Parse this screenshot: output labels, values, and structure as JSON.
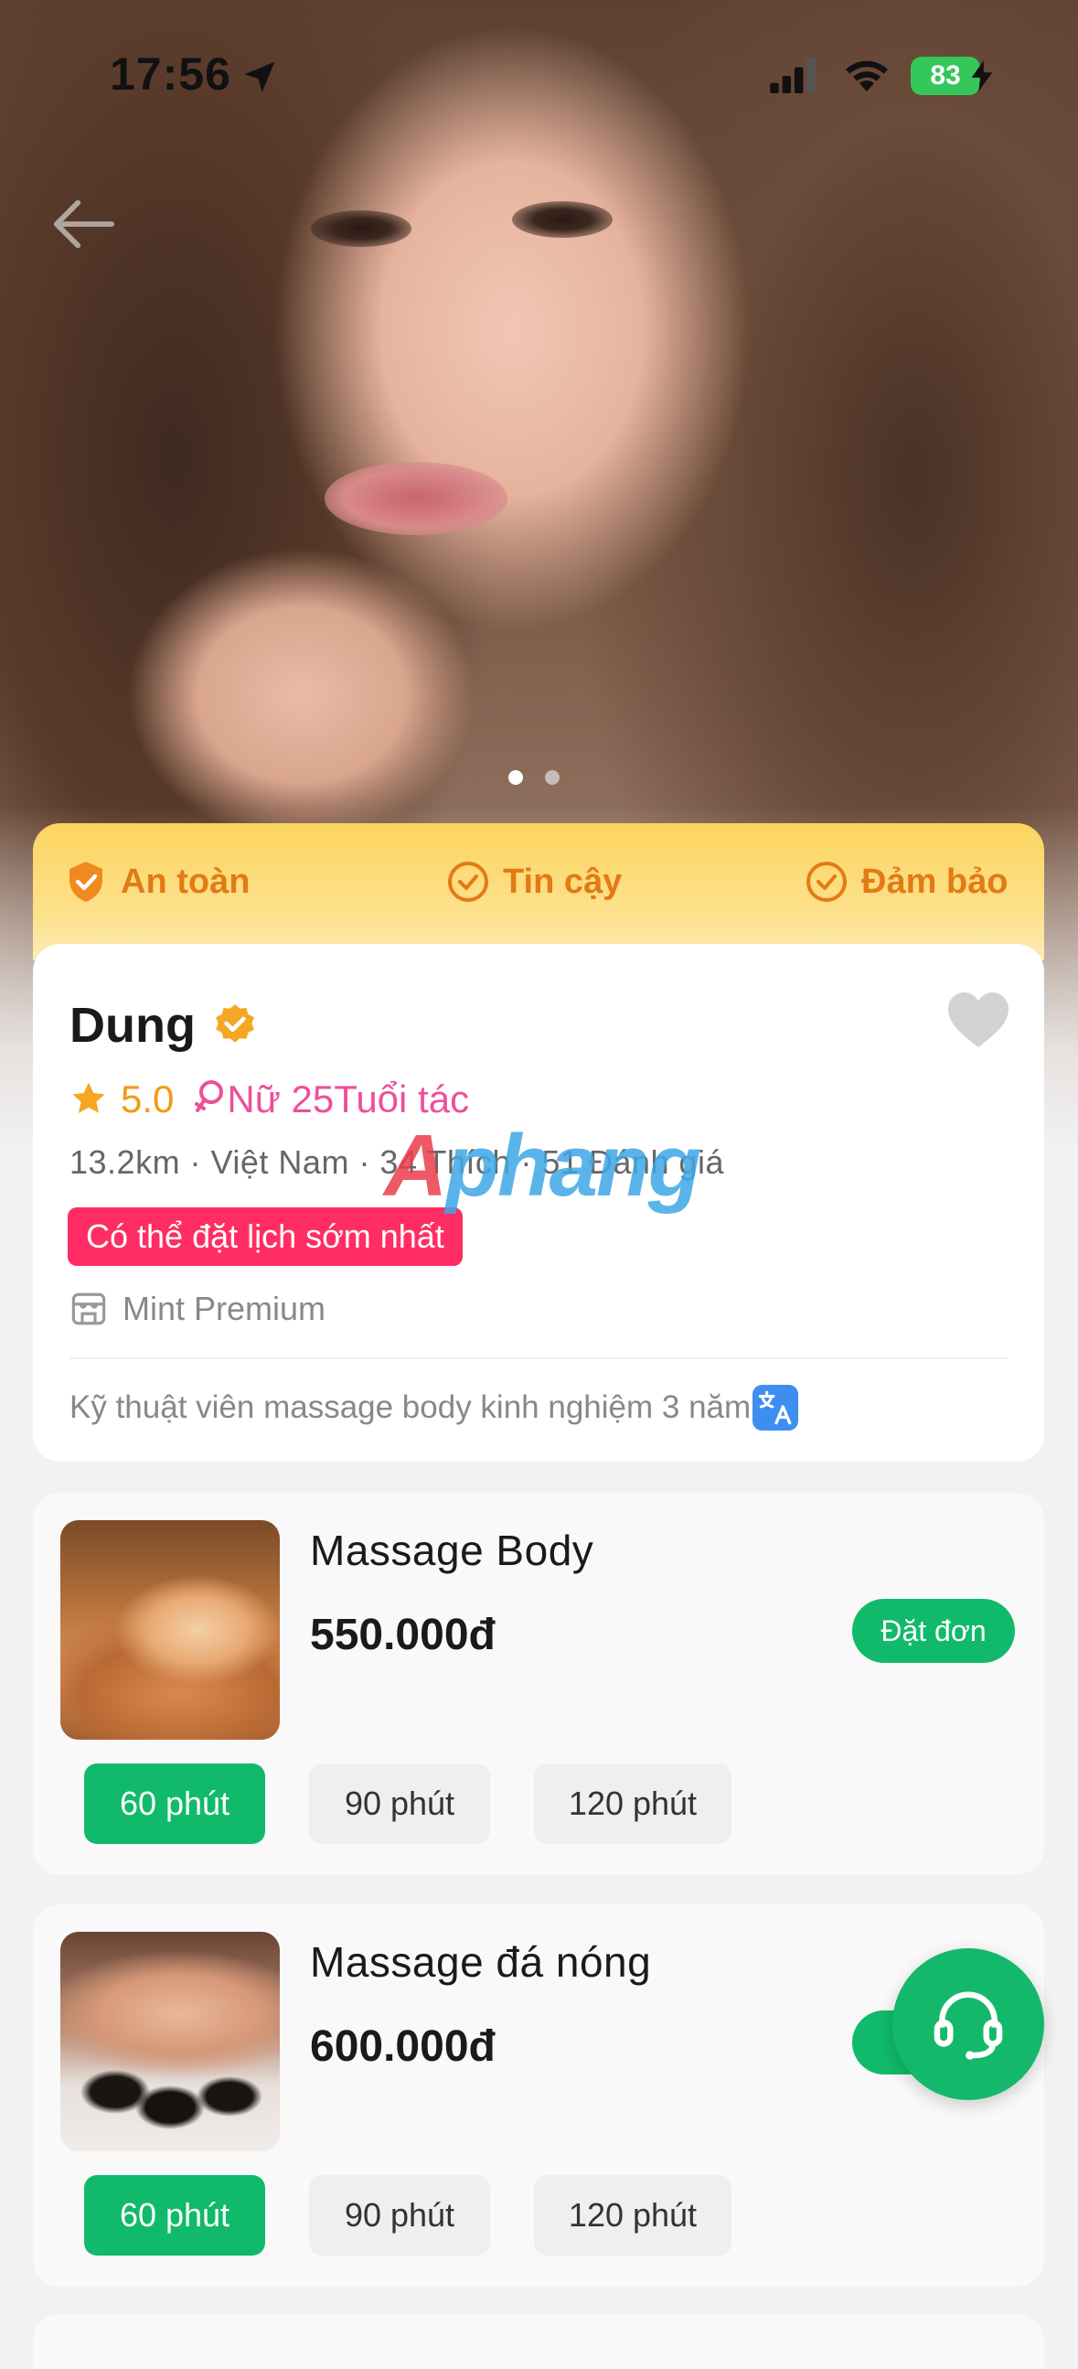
{
  "status_bar": {
    "time": "17:56",
    "battery": "83"
  },
  "trust_banner": {
    "items": [
      "An toàn",
      "Tin cậy",
      "Đảm bảo"
    ]
  },
  "profile": {
    "name": "Dung",
    "rating": "5.0",
    "gender_age": "Nữ 25Tuổi tác",
    "meta": "13.2km · Việt Nam · 34 Thích · 51 Đánh giá",
    "availability_badge": "Có thể đặt lịch sớm nhất",
    "store": "Mint Premium",
    "bio": "Kỹ thuật viên massage body kinh nghiệm 3 năm"
  },
  "watermark": {
    "part1": "A",
    "part2": "phang"
  },
  "services": [
    {
      "title": "Massage Body",
      "price": "550.000đ",
      "order_label": "Đặt đơn",
      "durations": [
        "60 phút",
        "90 phút",
        "120 phút"
      ],
      "selected_duration": 0
    },
    {
      "title": "Massage đá nóng",
      "price": "600.000đ",
      "order_label": "Đ",
      "durations": [
        "60 phút",
        "90 phút",
        "120 phút"
      ],
      "selected_duration": 0
    }
  ],
  "colors": {
    "accent_green": "#11ba6a",
    "badge_pink": "#ff2d63",
    "rating_orange": "#f39a14",
    "gender_pink": "#ee4f9b",
    "trust_orange": "#e37a16"
  },
  "icons": [
    "location-arrow-icon",
    "signal-icon",
    "wifi-icon",
    "battery-icon",
    "back-arrow-icon",
    "shield-check-icon",
    "check-circle-icon",
    "verified-badge-icon",
    "heart-icon",
    "star-icon",
    "female-icon",
    "store-icon",
    "translate-icon",
    "headset-icon"
  ]
}
